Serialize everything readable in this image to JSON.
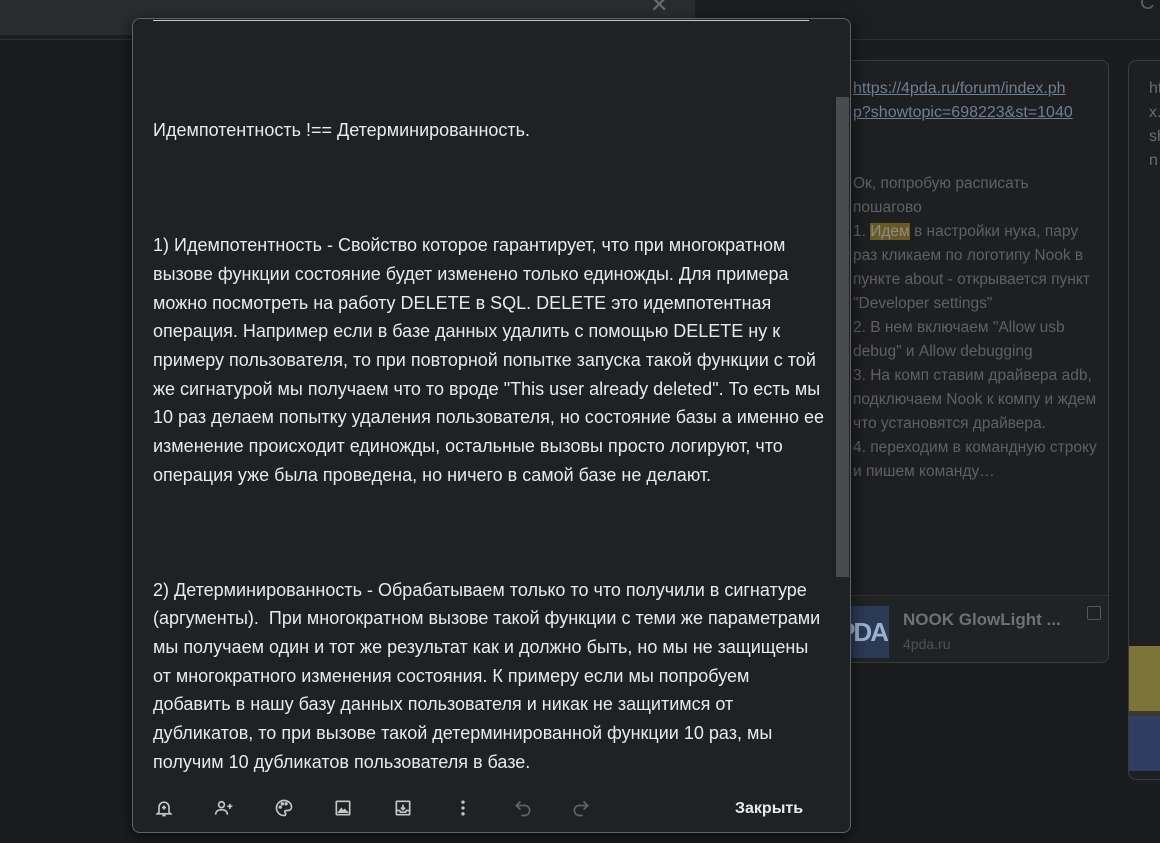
{
  "background": {
    "close_glyph": "✕",
    "card": {
      "link": "https://4pda.ru/forum/index.php?showtopic=698223&st=1040",
      "lines": [
        "Ок, попробую расписать пошагово",
        "1. ",
        "Идем",
        " в настройки нука, пару раз кликаем по логотипу Nook в пункте about - открывается пункт \"Developer settings\"",
        "2. В нем включаем \"Allow usb debug\" и Allow debugging",
        "3. На комп ставим драйвера adb, подключаем Nook к компу и ждем что установятся драйвера.",
        "4. переходим в командную строку и пишем команду…"
      ],
      "preview_title": "NOOK GlowLight ...",
      "preview_site": "4pda.ru",
      "preview_thumb": "PDA"
    },
    "card2_text": "htx.shn"
  },
  "note": {
    "title": "Идемпотентность !== Детерминированность.",
    "paragraph1": "1) Идемпотентность - Свойство которое гарантирует, что при многократном вызове функции состояние будет изменено только единожды. Для примера можно посмотреть на работу DELETE в SQL. DELETE это идемпотентная операция. Например если в базе данных удалить с помощью DELETE ну к примеру пользователя, то при повторной попытке запуска такой функции с той же сигнатурой мы получаем что то вроде \"This user already deleted\". То есть мы 10 раз делаем попытку удаления пользователя, но состояние базы а именно ее изменение происходит единожды, остальные вызовы просто логируют, что операция уже была проведена, но ничего в самой базе не делают.",
    "paragraph2": "2) Детерминированность - Обрабатываем только то что получили в сигнатуре (аргументы).  При многократном вызове такой функции с теми же параметрами мы получаем один и тот же результат как и должно быть, но мы не защищены от многократного изменения состояния. К примеру если мы попробуем добавить в нашу базу данных пользователя и никак не защитимся от дубликатов, то при вызове такой детерминированной функции 10 раз, мы получим 10 дубликатов пользователя в базе."
  },
  "toolbar": {
    "icons": [
      "remind-icon",
      "collaborator-icon",
      "palette-icon",
      "image-icon",
      "archive-icon",
      "more-icon",
      "undo-icon",
      "redo-icon"
    ],
    "close_label": "Закрыть"
  },
  "colors": {
    "dialog_bg": "#202124",
    "text": "#e8eaed",
    "link": "#6e7f95",
    "highlight": "#6a5a22"
  }
}
